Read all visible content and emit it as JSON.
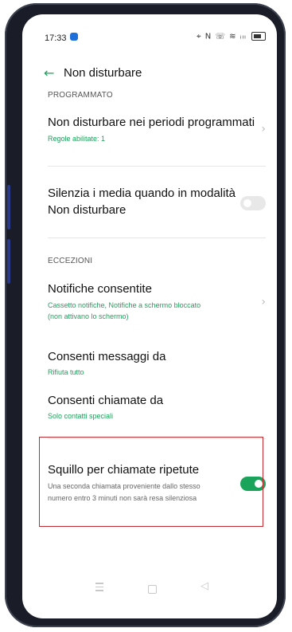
{
  "status_bar": {
    "time": "17:33",
    "icons_text": "⌖ N ☏ ≋ ᵢₗₗ"
  },
  "header": {
    "back_icon": "←",
    "title": "Non disturbare"
  },
  "sections": {
    "scheduled": "PROGRAMMATO",
    "exceptions": "ECCEZIONI"
  },
  "items": {
    "scheduled_periods": {
      "title": "Non disturbare nei periodi programmati",
      "subtitle": "Regole abilitate: 1"
    },
    "silence_media": {
      "title_line1": "Silenzia i media quando in modalità",
      "title_line2": "Non disturbare",
      "toggle_on": false
    },
    "allowed_notifications": {
      "title": "Notifiche consentite",
      "subtitle_line1": "Cassetto notifiche, Notifiche a schermo bloccato",
      "subtitle_line2": "(non attivano lo schermo)"
    },
    "allow_messages": {
      "title": "Consenti messaggi da",
      "subtitle": "Rifiuta tutto"
    },
    "allow_calls": {
      "title": "Consenti chiamate da",
      "subtitle": "Solo contatti speciali"
    },
    "repeat_calls": {
      "title": "Squillo per chiamate ripetute",
      "desc_line1": "Una seconda chiamata proveniente dallo stesso",
      "desc_line2": "numero entro 3 minuti non sarà resa silenziosa",
      "toggle_on": true
    }
  },
  "nav": {
    "back_glyph": "◁"
  },
  "colors": {
    "accent": "#1aa35a",
    "highlight": "#c0292f"
  }
}
